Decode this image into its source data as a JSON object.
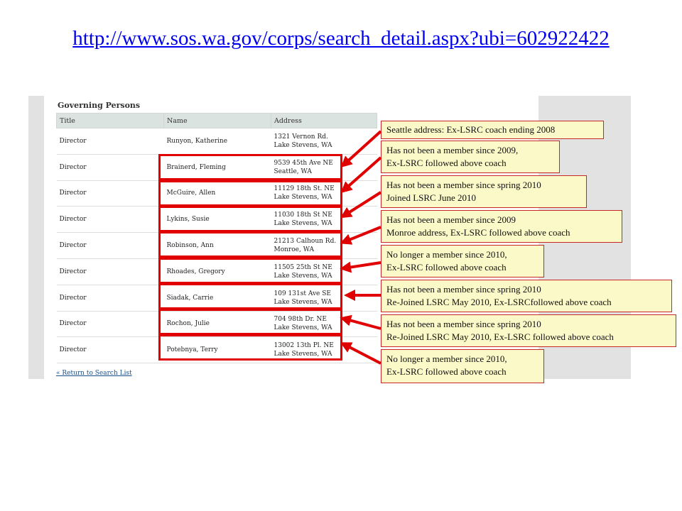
{
  "slide": {
    "url": "http://www.sos.wa.gov/corps/search_detail.aspx?ubi=602922422"
  },
  "screenshot": {
    "section_title": "Governing Persons",
    "columns": [
      "Title",
      "Name",
      "Address"
    ],
    "rows": [
      {
        "title": "Director",
        "name": "Runyon, Katherine",
        "address": [
          "1321 Vernon Rd.",
          "Lake Stevens, WA"
        ]
      },
      {
        "title": "Director",
        "name": "Brainerd, Fleming",
        "address": [
          "9539 45th Ave NE",
          "Seattle, WA"
        ]
      },
      {
        "title": "Director",
        "name": "McGuire, Allen",
        "address": [
          "11129 18th St. NE",
          "Lake Stevens, WA"
        ]
      },
      {
        "title": "Director",
        "name": "Lykins, Susie",
        "address": [
          "11030 18th St NE",
          "Lake Stevens, WA"
        ]
      },
      {
        "title": "Director",
        "name": "Robinson, Ann",
        "address": [
          "21213 Calhoun Rd.",
          "Monroe, WA"
        ]
      },
      {
        "title": "Director",
        "name": "Rhoades, Gregory",
        "address": [
          "11505 25th St NE",
          "Lake Stevens, WA"
        ]
      },
      {
        "title": "Director",
        "name": "Siadak, Carrie",
        "address": [
          "109 131st Ave SE",
          "Lake Stevens, WA"
        ]
      },
      {
        "title": "Director",
        "name": "Rochon, Julie",
        "address": [
          "704 98th Dr. NE",
          "Lake Stevens, WA"
        ]
      },
      {
        "title": "Director",
        "name": "Potebnya, Terry",
        "address": [
          "13002 13th Pl. NE",
          "Lake Stevens, WA"
        ]
      }
    ],
    "return_link": "« Return to Search List"
  },
  "callouts": [
    {
      "lines": [
        "Seattle address: Ex-LSRC coach ending 2008"
      ]
    },
    {
      "lines": [
        "Has not been a member since 2009,",
        "Ex-LSRC followed above coach"
      ]
    },
    {
      "lines": [
        "Has not been a member since spring 2010",
        "Joined LSRC June 2010"
      ]
    },
    {
      "lines": [
        "Has not been a member since 2009",
        "Monroe address, Ex-LSRC followed above coach"
      ]
    },
    {
      "lines": [
        "No longer a member since 2010,",
        "Ex-LSRC followed above coach"
      ]
    },
    {
      "lines": [
        "Has not been a member since spring 2010",
        "Re-Joined LSRC May 2010, Ex-LSRCfollowed above coach"
      ]
    },
    {
      "lines": [
        "Has not been a member since spring 2010",
        "Re-Joined LSRC May 2010, Ex-LSRC followed above coach"
      ]
    },
    {
      "lines": [
        "No longer a member since 2010,",
        "Ex-LSRC followed above coach"
      ]
    }
  ],
  "colors": {
    "annotation_red": "#e00000",
    "callout_fill": "#fcf9c8",
    "link_blue": "#0000ee"
  }
}
